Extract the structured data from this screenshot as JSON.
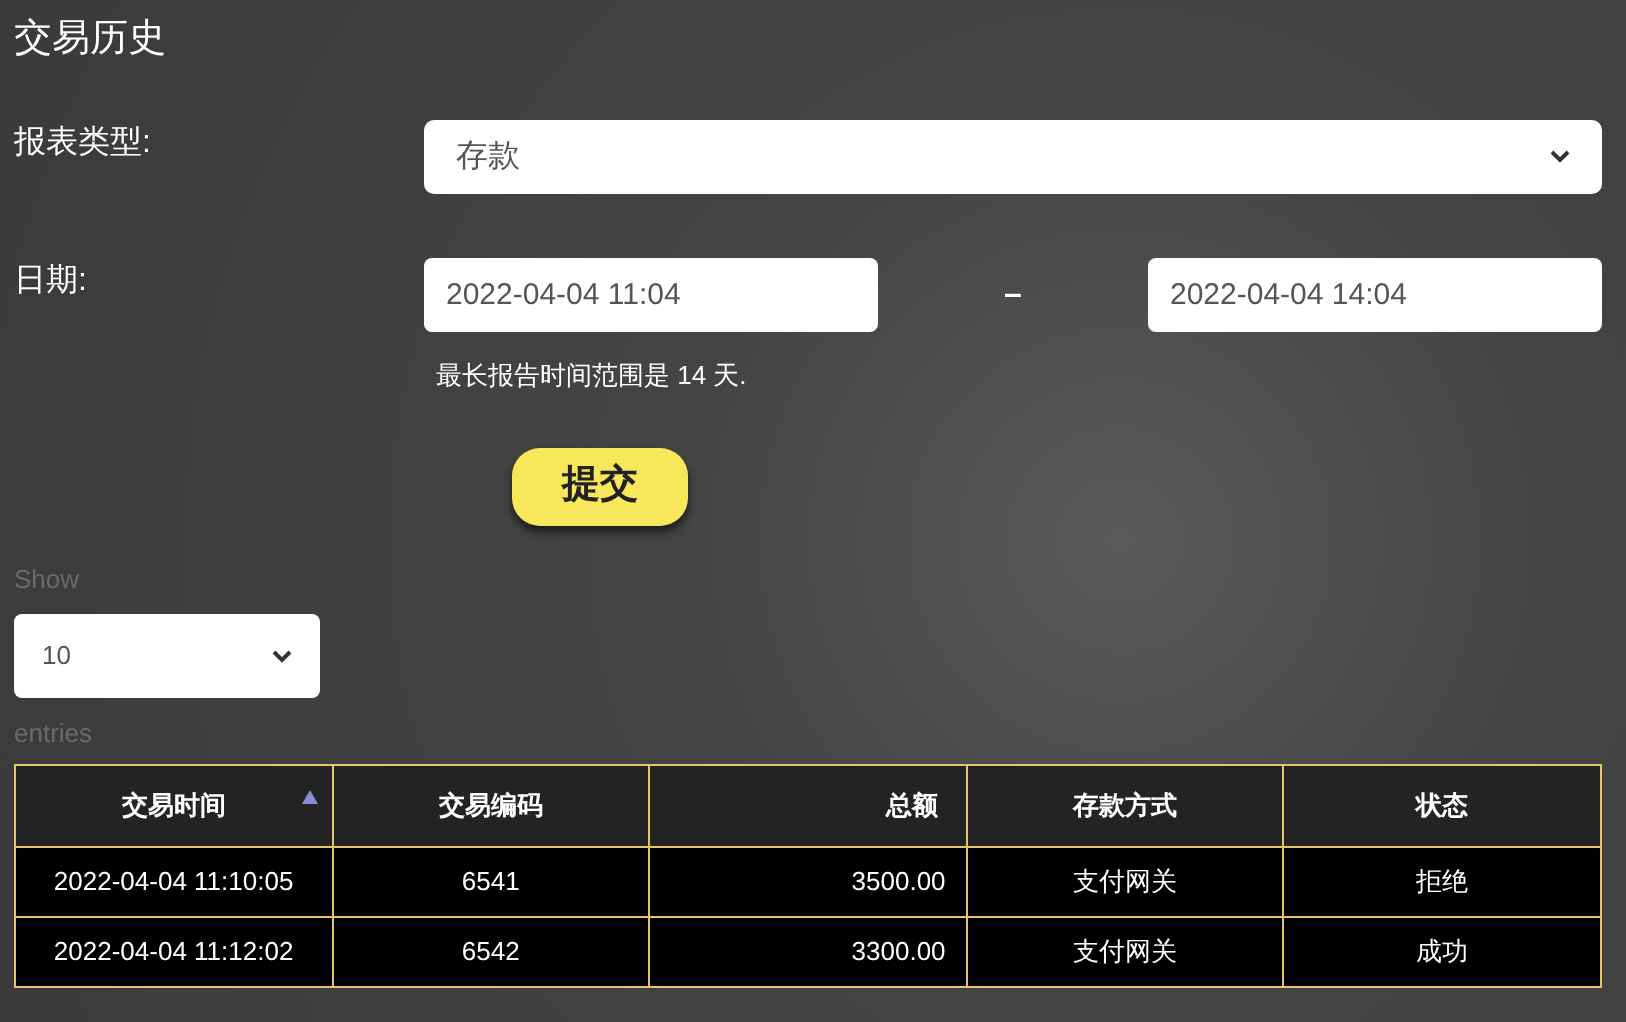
{
  "title": "交易历史",
  "report_type": {
    "label": "报表类型:",
    "value": "存款"
  },
  "date": {
    "label": "日期:",
    "from": "2022-04-04 11:04",
    "separator": "–",
    "to": "2022-04-04 14:04",
    "hint": "最长报告时间范围是 14 天."
  },
  "submit": "提交",
  "page_size": {
    "before": "Show",
    "value": "10",
    "after": "entries"
  },
  "table": {
    "columns": [
      {
        "label": "交易时间",
        "kind": "text",
        "sorted": true
      },
      {
        "label": "交易编码",
        "kind": "text",
        "sorted": false
      },
      {
        "label": "总额",
        "kind": "number",
        "sorted": false
      },
      {
        "label": "存款方式",
        "kind": "text",
        "sorted": false
      },
      {
        "label": "状态",
        "kind": "text",
        "sorted": false
      }
    ],
    "rows": [
      [
        "2022-04-04 11:10:05",
        "6541",
        "3500.00",
        "支付网关",
        "拒绝"
      ],
      [
        "2022-04-04 11:12:02",
        "6542",
        "3300.00",
        "支付网关",
        "成功"
      ]
    ]
  }
}
